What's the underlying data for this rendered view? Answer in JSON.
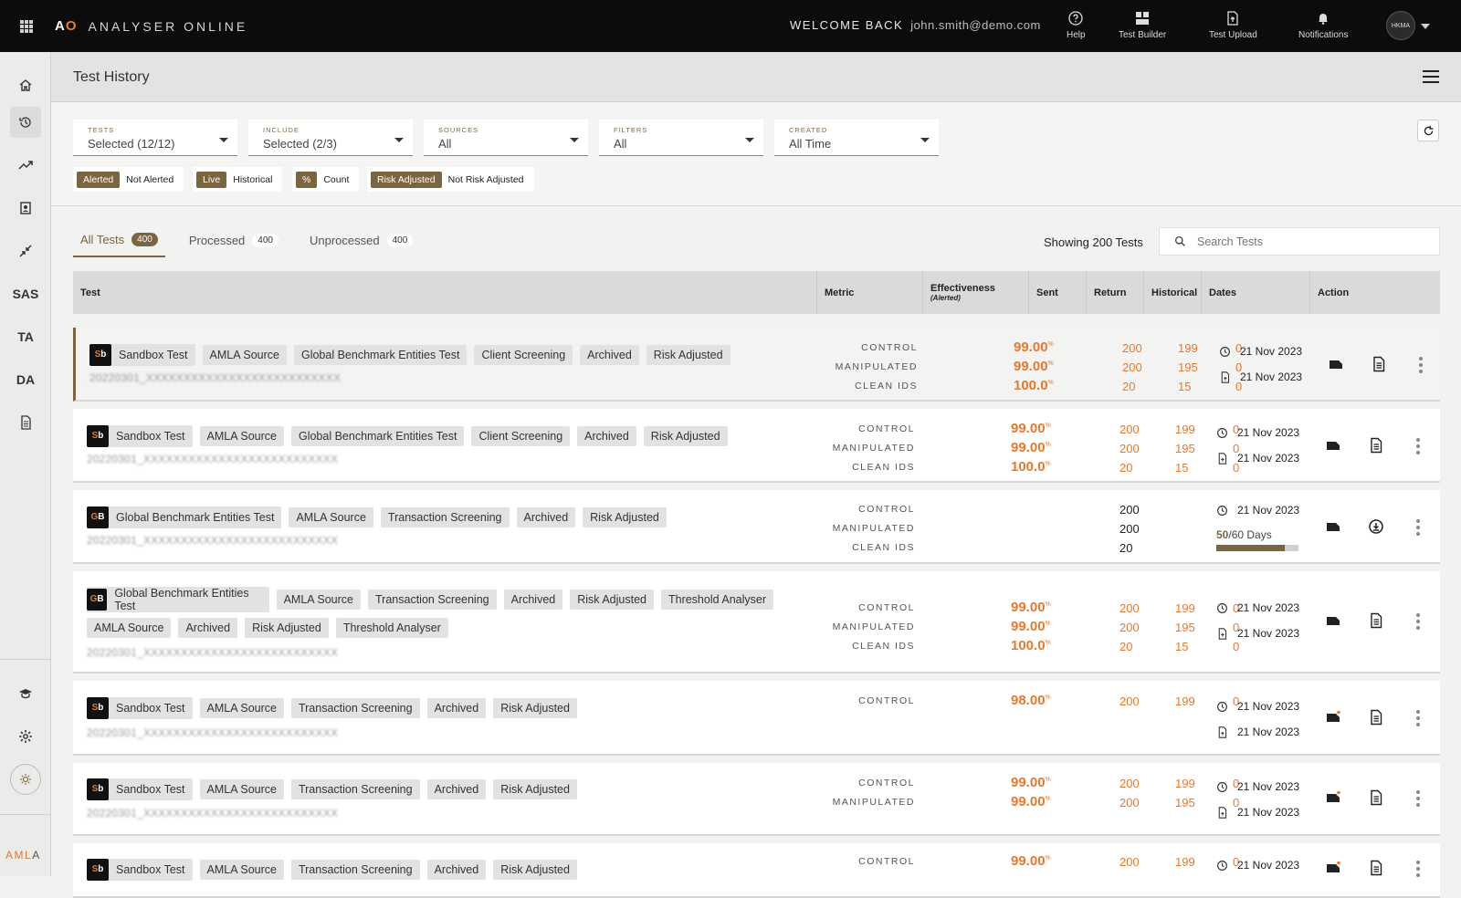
{
  "topbar": {
    "logo_mark_a": "A",
    "logo_mark_o": "O",
    "logo_name": "ANALYSER ONLINE",
    "welcome": "WELCOME BACK",
    "email": "john.smith@demo.com",
    "help": "Help",
    "test_builder": "Test Builder",
    "test_upload": "Test Upload",
    "notifications": "Notifications",
    "avatar": "HKMA"
  },
  "sidebar": {
    "items": [
      "home-icon",
      "history-icon",
      "trend-icon",
      "badge-icon",
      "compress-icon",
      "SAS",
      "TA",
      "DA",
      "document-icon"
    ],
    "amla_a": "AML",
    "amla_b": "A"
  },
  "header": {
    "title": "Test History"
  },
  "filters": {
    "tests": {
      "label": "TESTS",
      "value": "Selected (12/12)"
    },
    "include": {
      "label": "INCLUDE",
      "value": "Selected (2/3)"
    },
    "sources": {
      "label": "SOURCES",
      "value": "All"
    },
    "filters": {
      "label": "FILTERS",
      "value": "All"
    },
    "created": {
      "label": "CREATED",
      "value": "All Time"
    }
  },
  "toggles": [
    {
      "on": "Alerted",
      "off": "Not Alerted"
    },
    {
      "on": "Live",
      "off": "Historical"
    },
    {
      "on": "%",
      "off": "Count"
    },
    {
      "on": "Risk Adjusted",
      "off": "Not Risk Adjusted"
    }
  ],
  "tabs": [
    {
      "label": "All Tests",
      "count": "400"
    },
    {
      "label": "Processed",
      "count": "400"
    },
    {
      "label": "Unprocessed",
      "count": "400"
    }
  ],
  "showing": "Showing 200 Tests",
  "search": {
    "placeholder": "Search Tests"
  },
  "table": {
    "headers": {
      "test": "Test",
      "metric": "Metric",
      "effectiveness": "Effectiveness",
      "effectiveness_sub": "(Alerted)",
      "sent": "Sent",
      "return": "Return",
      "historical": "Historical",
      "dates": "Dates",
      "action": "Action"
    }
  },
  "rows": [
    {
      "badge": [
        "S",
        "b"
      ],
      "tags": [
        "Sandbox Test",
        "AMLA Source",
        "Global Benchmark Entities Test",
        "Client Screening",
        "Archived",
        "Risk Adjusted"
      ],
      "code": "20220301_XXXXXXXXXXXXXXXXXXXXXXXXXX",
      "metrics": [
        {
          "name": "CONTROL",
          "eff": "99.00",
          "unit": "%",
          "sent": "200",
          "ret": "199",
          "hist": "0"
        },
        {
          "name": "MANIPULATED",
          "eff": "99.00",
          "unit": "%",
          "sent": "200",
          "ret": "195",
          "hist": "0"
        },
        {
          "name": "CLEAN IDS",
          "eff": "100.0",
          "unit": "%",
          "sent": "20",
          "ret": "15",
          "hist": "0"
        }
      ],
      "date1": "21 Nov 2023",
      "date2": "21 Nov 2023"
    },
    {
      "badge": [
        "S",
        "b"
      ],
      "tags": [
        "Sandbox Test",
        "AMLA Source",
        "Global Benchmark Entities Test",
        "Client Screening",
        "Archived",
        "Risk Adjusted"
      ],
      "code": "20220301_XXXXXXXXXXXXXXXXXXXXXXXXXX",
      "metrics": [
        {
          "name": "CONTROL",
          "eff": "99.00",
          "unit": "%",
          "sent": "200",
          "ret": "199",
          "hist": "0"
        },
        {
          "name": "MANIPULATED",
          "eff": "99.00",
          "unit": "%",
          "sent": "200",
          "ret": "195",
          "hist": "0"
        },
        {
          "name": "CLEAN IDS",
          "eff": "100.0",
          "unit": "%",
          "sent": "20",
          "ret": "15",
          "hist": "0"
        }
      ],
      "date1": "21 Nov 2023",
      "date2": "21 Nov 2023"
    },
    {
      "badge": [
        "G",
        "B"
      ],
      "tags": [
        "Global Benchmark Entities Test",
        "AMLA Source",
        "Transaction Screening",
        "Archived",
        "Risk Adjusted"
      ],
      "code": "20220301_XXXXXXXXXXXXXXXXXXXXXXXXXX",
      "metrics": [
        {
          "name": "CONTROL",
          "sent": "200"
        },
        {
          "name": "MANIPULATED",
          "sent": "200"
        },
        {
          "name": "CLEAN IDS",
          "sent": "20"
        }
      ],
      "date1": "21 Nov 2023",
      "progress_value": "50",
      "progress_total": "/60 Days",
      "progress_fraction": 0.8333
    },
    {
      "badge": [
        "G",
        "B"
      ],
      "tags": [
        "Global Benchmark Entities Test",
        "AMLA Source",
        "Transaction Screening",
        "Archived",
        "Risk Adjusted",
        "Threshold Analyser"
      ],
      "tags2": [
        "AMLA Source",
        "Archived",
        "Risk Adjusted",
        "Threshold Analyser"
      ],
      "code": "20220301_XXXXXXXXXXXXXXXXXXXXXXXXXX",
      "metrics": [
        {
          "name": "CONTROL",
          "eff": "99.00",
          "unit": "%",
          "sent": "200",
          "ret": "199",
          "hist": "0"
        },
        {
          "name": "MANIPULATED",
          "eff": "99.00",
          "unit": "%",
          "sent": "200",
          "ret": "195",
          "hist": "0"
        },
        {
          "name": "CLEAN IDS",
          "eff": "100.0",
          "unit": "%",
          "sent": "20",
          "ret": "15",
          "hist": "0"
        }
      ],
      "date1": "21 Nov 2023",
      "date2": "21 Nov 2023"
    },
    {
      "badge": [
        "S",
        "b"
      ],
      "tags": [
        "Sandbox Test",
        "AMLA Source",
        "Transaction Screening",
        "Archived",
        "Risk Adjusted"
      ],
      "code": "20220301_XXXXXXXXXXXXXXXXXXXXXXXXXX",
      "metrics": [
        {
          "name": "CONTROL",
          "eff": "98.00",
          "unit": "%",
          "sent": "200",
          "ret": "199",
          "hist": "0"
        }
      ],
      "date1": "21 Nov 2023",
      "date2": "21 Nov 2023"
    },
    {
      "badge": [
        "S",
        "b"
      ],
      "tags": [
        "Sandbox Test",
        "AMLA Source",
        "Transaction Screening",
        "Archived",
        "Risk Adjusted"
      ],
      "code": "20220301_XXXXXXXXXXXXXXXXXXXXXXXXXX",
      "metrics": [
        {
          "name": "CONTROL",
          "eff": "99.00",
          "unit": "%",
          "sent": "200",
          "ret": "199",
          "hist": "0"
        },
        {
          "name": "MANIPULATED",
          "eff": "99.00",
          "unit": "%",
          "sent": "200",
          "ret": "195",
          "hist": "0"
        }
      ],
      "date1": "21 Nov 2023",
      "date2": "21 Nov 2023"
    },
    {
      "badge": [
        "S",
        "b"
      ],
      "tags": [
        "Sandbox Test",
        "AMLA Source",
        "Transaction Screening",
        "Archived",
        "Risk Adjusted"
      ],
      "metrics": [
        {
          "name": "CONTROL",
          "eff": "99.00",
          "unit": "%",
          "sent": "200",
          "ret": "199",
          "hist": "0"
        }
      ],
      "date1": "21 Nov 2023"
    }
  ],
  "colors": {
    "accent": "#7b6440",
    "orange": "#e8782c",
    "topbar": "#0c0c0c"
  }
}
